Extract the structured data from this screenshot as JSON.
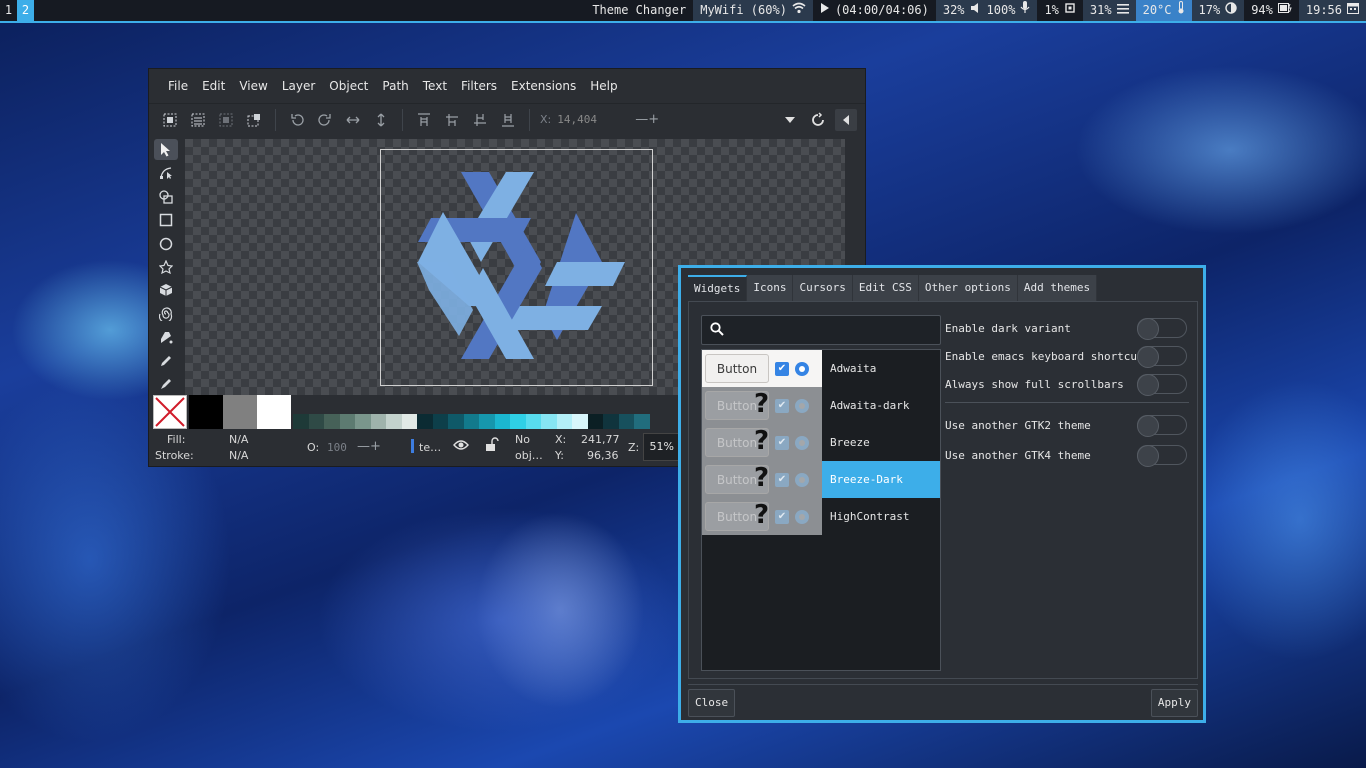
{
  "topbar": {
    "workspaces": [
      "1",
      "2"
    ],
    "window_title": "Theme Changer",
    "wifi": "MyWifi (60%)",
    "media": "(04:00/04:06)",
    "volume": "32%",
    "mic": "100%",
    "cpu": "1%",
    "memory": "31%",
    "temperature": "20°C",
    "brightness": "17%",
    "battery": "94%",
    "clock": "19:56"
  },
  "inkscape": {
    "menu": [
      "File",
      "Edit",
      "View",
      "Layer",
      "Object",
      "Path",
      "Text",
      "Filters",
      "Extensions",
      "Help"
    ],
    "x_label": "X:",
    "x_value": "14,404",
    "fill_label": "Fill:",
    "fill_value": "N/A",
    "stroke_label": "Stroke:",
    "stroke_value": "N/A",
    "opacity_label": "O:",
    "opacity_value": "100",
    "layer_value": "te…",
    "no_obj_line1": "No",
    "no_obj_line2": "obj…",
    "coord_x_label": "X:",
    "coord_x_value": "241,77",
    "coord_y_label": "Y:",
    "coord_y_value": "96,36",
    "zoom_label": "Z:",
    "zoom_value": "51%",
    "palette_colors": [
      "#1e3a38",
      "#2f4a46",
      "#466158",
      "#5d7b71",
      "#7a968c",
      "#9fb3ac",
      "#c3d2cd",
      "#e1e9e6",
      "#0b2b33",
      "#0d3f4a",
      "#0f5968",
      "#127a8c",
      "#1697ad",
      "#1bb7d0",
      "#2fd0e6",
      "#58dcee",
      "#86e5f3",
      "#b3eff8",
      "#d8f6fb",
      "#0b1f24",
      "#10343d",
      "#17505d",
      "#216d7d"
    ]
  },
  "theme_changer": {
    "tabs": [
      "Widgets",
      "Icons",
      "Cursors",
      "Edit CSS",
      "Other options",
      "Add themes"
    ],
    "search_placeholder": "",
    "preview_button_label": "Button",
    "themes": [
      {
        "name": "Adwaita",
        "selected": false,
        "preview": "light"
      },
      {
        "name": "Adwaita-dark",
        "selected": false,
        "preview": "unknown"
      },
      {
        "name": "Breeze",
        "selected": false,
        "preview": "unknown"
      },
      {
        "name": "Breeze-Dark",
        "selected": true,
        "preview": "unknown"
      },
      {
        "name": "HighContrast",
        "selected": false,
        "preview": "unknown"
      }
    ],
    "options_group1": [
      "Enable dark variant",
      "Enable emacs keyboard shortcuts",
      "Always show full scrollbars"
    ],
    "options_group2": [
      "Use another GTK2 theme",
      "Use another GTK4 theme"
    ],
    "close_label": "Close",
    "apply_label": "Apply",
    "accent_color": "#3daee9"
  }
}
